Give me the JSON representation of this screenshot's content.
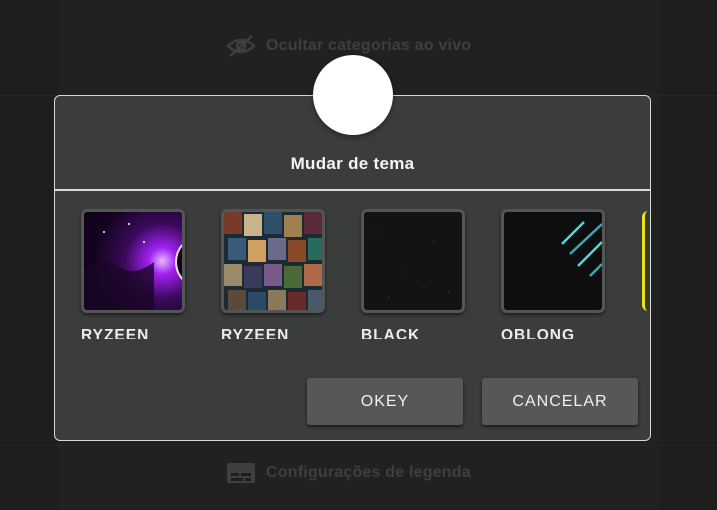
{
  "background": {
    "hide_live_categories_label": "Ocultar categorias ao vivo",
    "subtitle_settings_label": "Configurações de legenda"
  },
  "dialog": {
    "title": "Mudar de tema",
    "themes": [
      {
        "name": "RYZEEN PURPLE"
      },
      {
        "name": "RYZEEN STREAM"
      },
      {
        "name": "BLACK DIAMOND"
      },
      {
        "name": "OBLONG CYANO"
      }
    ],
    "ok_label": "OKEY",
    "cancel_label": "CANCELAR"
  },
  "colors": {
    "dialog_bg": "#3b3c3c",
    "dialog_border": "#d9d9d9",
    "button_bg": "#565858",
    "partial_theme_accent": "#e8e31a"
  }
}
